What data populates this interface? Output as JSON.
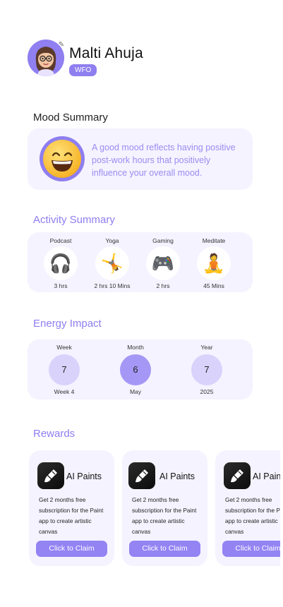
{
  "profile": {
    "name": "Malti Ahuja",
    "badge": "WFO",
    "avatar_bg": "#8f7ff0"
  },
  "mood": {
    "title": "Mood Summary",
    "emoji": "grinning-face",
    "text": "A good mood reflects having positive post-work hours that positively influence your overall mood."
  },
  "activity": {
    "title": "Activity Summary",
    "items": [
      {
        "name": "Podcast",
        "icon": "headphones-icon",
        "glyph": "🎧",
        "value": "3 hrs"
      },
      {
        "name": "Yoga",
        "icon": "yoga-icon",
        "glyph": "🤸",
        "value": "2 hrs 10 Mins"
      },
      {
        "name": "Gaming",
        "icon": "gamepad-icon",
        "glyph": "🎮",
        "value": "2 hrs"
      },
      {
        "name": "Meditate",
        "icon": "meditate-icon",
        "glyph": "🧘",
        "value": "45 Mins"
      }
    ]
  },
  "energy": {
    "title": "Energy Impact",
    "items": [
      {
        "label": "Week",
        "value": "7",
        "sub": "Week 4"
      },
      {
        "label": "Month",
        "value": "6",
        "sub": "May"
      },
      {
        "label": "Year",
        "value": "7",
        "sub": "2025"
      }
    ]
  },
  "rewards": {
    "title": "Rewards",
    "cards": [
      {
        "title": "AI Paints",
        "desc": [
          "Get 2 months free",
          "subscription for the Paint",
          "app to create artistic",
          "canvas"
        ],
        "button": "Click to Claim"
      },
      {
        "title": "AI Paints",
        "desc": [
          "Get 2 months free",
          "subscription for the Paint",
          "app to create artistic",
          "canvas"
        ],
        "button": "Click to Claim"
      },
      {
        "title": "AI Paints",
        "desc": [
          "Get 2 months free",
          "subscription for the Paint",
          "app to create artistic",
          "canvas"
        ],
        "button": "Click to Claim"
      }
    ]
  },
  "colors": {
    "accent": "#8e7ef0",
    "card_bg": "#f5f3ff",
    "energy_circle": "#d9d2fb",
    "energy_active": "#a597f5"
  }
}
